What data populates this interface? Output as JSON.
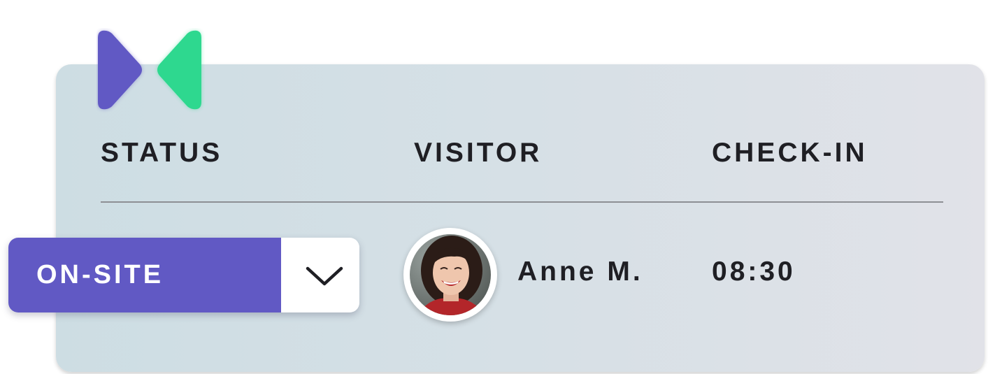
{
  "table": {
    "headers": {
      "status": "STATUS",
      "visitor": "VISITOR",
      "check_in": "CHECK-IN"
    },
    "rows": [
      {
        "status": "ON-SITE",
        "visitor_name": "Anne M.",
        "check_in_time": "08:30"
      }
    ]
  },
  "icons": {
    "logo": "brand-logo-icon",
    "dropdown": "chevron-down-icon",
    "avatar": "visitor-photo"
  },
  "colors": {
    "brand_purple": "#6159c4",
    "brand_green": "#2ed88f",
    "card_background": "#d6e0e6",
    "text": "#1f1f24"
  }
}
